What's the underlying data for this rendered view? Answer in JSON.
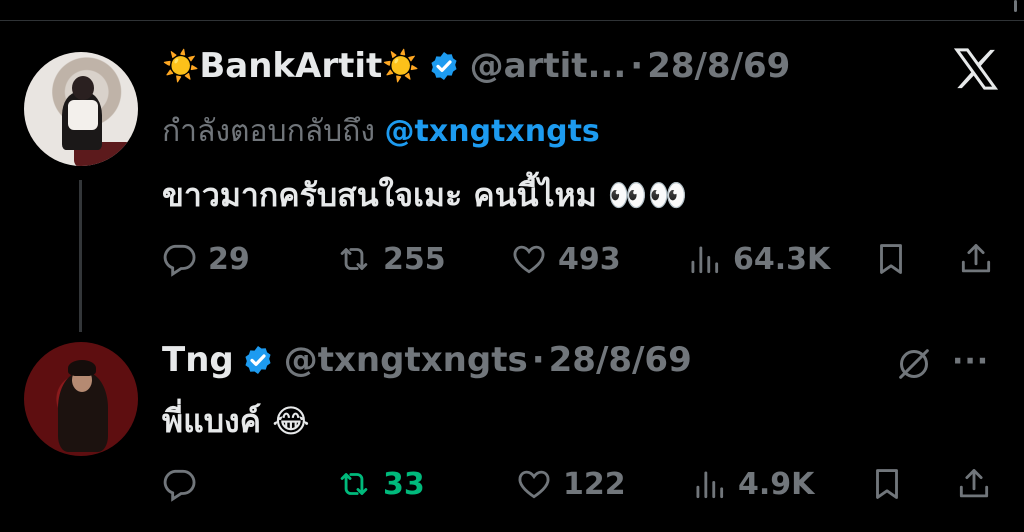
{
  "tweets": [
    {
      "display_name": "BankArtit",
      "name_emoji": "☀️",
      "handle": "@artit...",
      "separator": "·",
      "date": "28/8/69",
      "replying_label": "กำลังตอบกลับถึง",
      "replying_to": "@txngtxngts",
      "text": "ขาวมากครับสนใจเมะ คนนี้ไหม",
      "text_emoji": "👀👀",
      "replies": "29",
      "reposts": "255",
      "likes": "493",
      "views": "64.3K"
    },
    {
      "display_name": "Tng",
      "handle": "@txngtxngts",
      "separator": "·",
      "date": "28/8/69",
      "text": "พี่แบงค์",
      "text_emoji": "😂",
      "replies": "",
      "reposts": "33",
      "likes": "122",
      "views": "4.9K"
    }
  ],
  "icons": {
    "brand": "x-logo-icon",
    "more": "more-icon",
    "grok": "grok-icon",
    "more_glyph": "···"
  },
  "colors": {
    "background": "#000000",
    "text": "#e7e9ea",
    "muted": "#71767b",
    "link": "#1d9bf0",
    "repost_active": "#00ba7c",
    "verified": "#1d9bf0"
  }
}
